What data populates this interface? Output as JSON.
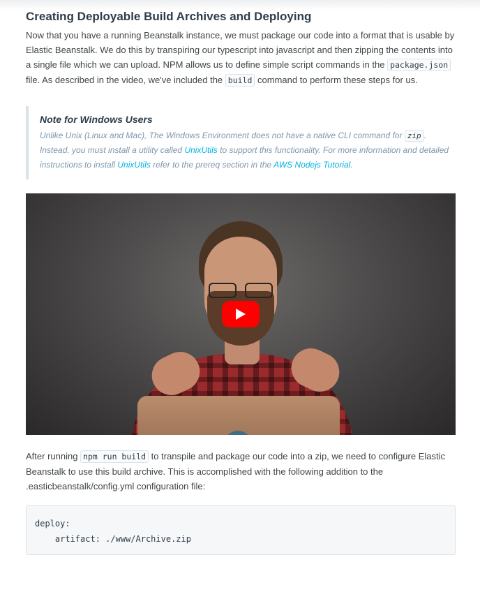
{
  "section": {
    "title": "Creating Deployable Build Archives and Deploying",
    "intro": {
      "t1": "Now that you have a running Beanstalk instance, we must package our code into a format that is usable by Elastic Beanstalk. We do this by transpiring our typescript into javascript and then zipping the contents into a single file which we can upload. NPM allows us to define simple script commands in the ",
      "code1": "package.json",
      "t2": " file. As described in the video, we've included the ",
      "code2": "build",
      "t3": " command to perform these steps for us."
    }
  },
  "note": {
    "heading": "Note for Windows Users",
    "t1": "Unlike Unix (Linux and Mac), The Windows Environment does not have a native CLI command for ",
    "code": "zip",
    "t2": ". Instead, you must install a utility called ",
    "link1": "UnixUtils",
    "t3": " to support this functionality. For more information and detailed instructions to install ",
    "link2": "UnixUtils",
    "t4": " refer to the prereq section in the ",
    "link3": "AWS Nodejs Tutorial",
    "t5": "."
  },
  "video": {
    "play_icon": "play-icon",
    "brand_color": "#ff0000"
  },
  "after": {
    "t1": "After running ",
    "code": "npm run build",
    "t2": " to transpile and package our code into a zip, we need to configure Elastic Beanstalk to use this build archive. This is accomplished with the following addition to the .easticbeanstalk/config.yml configuration file:"
  },
  "code_block": {
    "content": "deploy:\n    artifact: ./www/Archive.zip"
  }
}
